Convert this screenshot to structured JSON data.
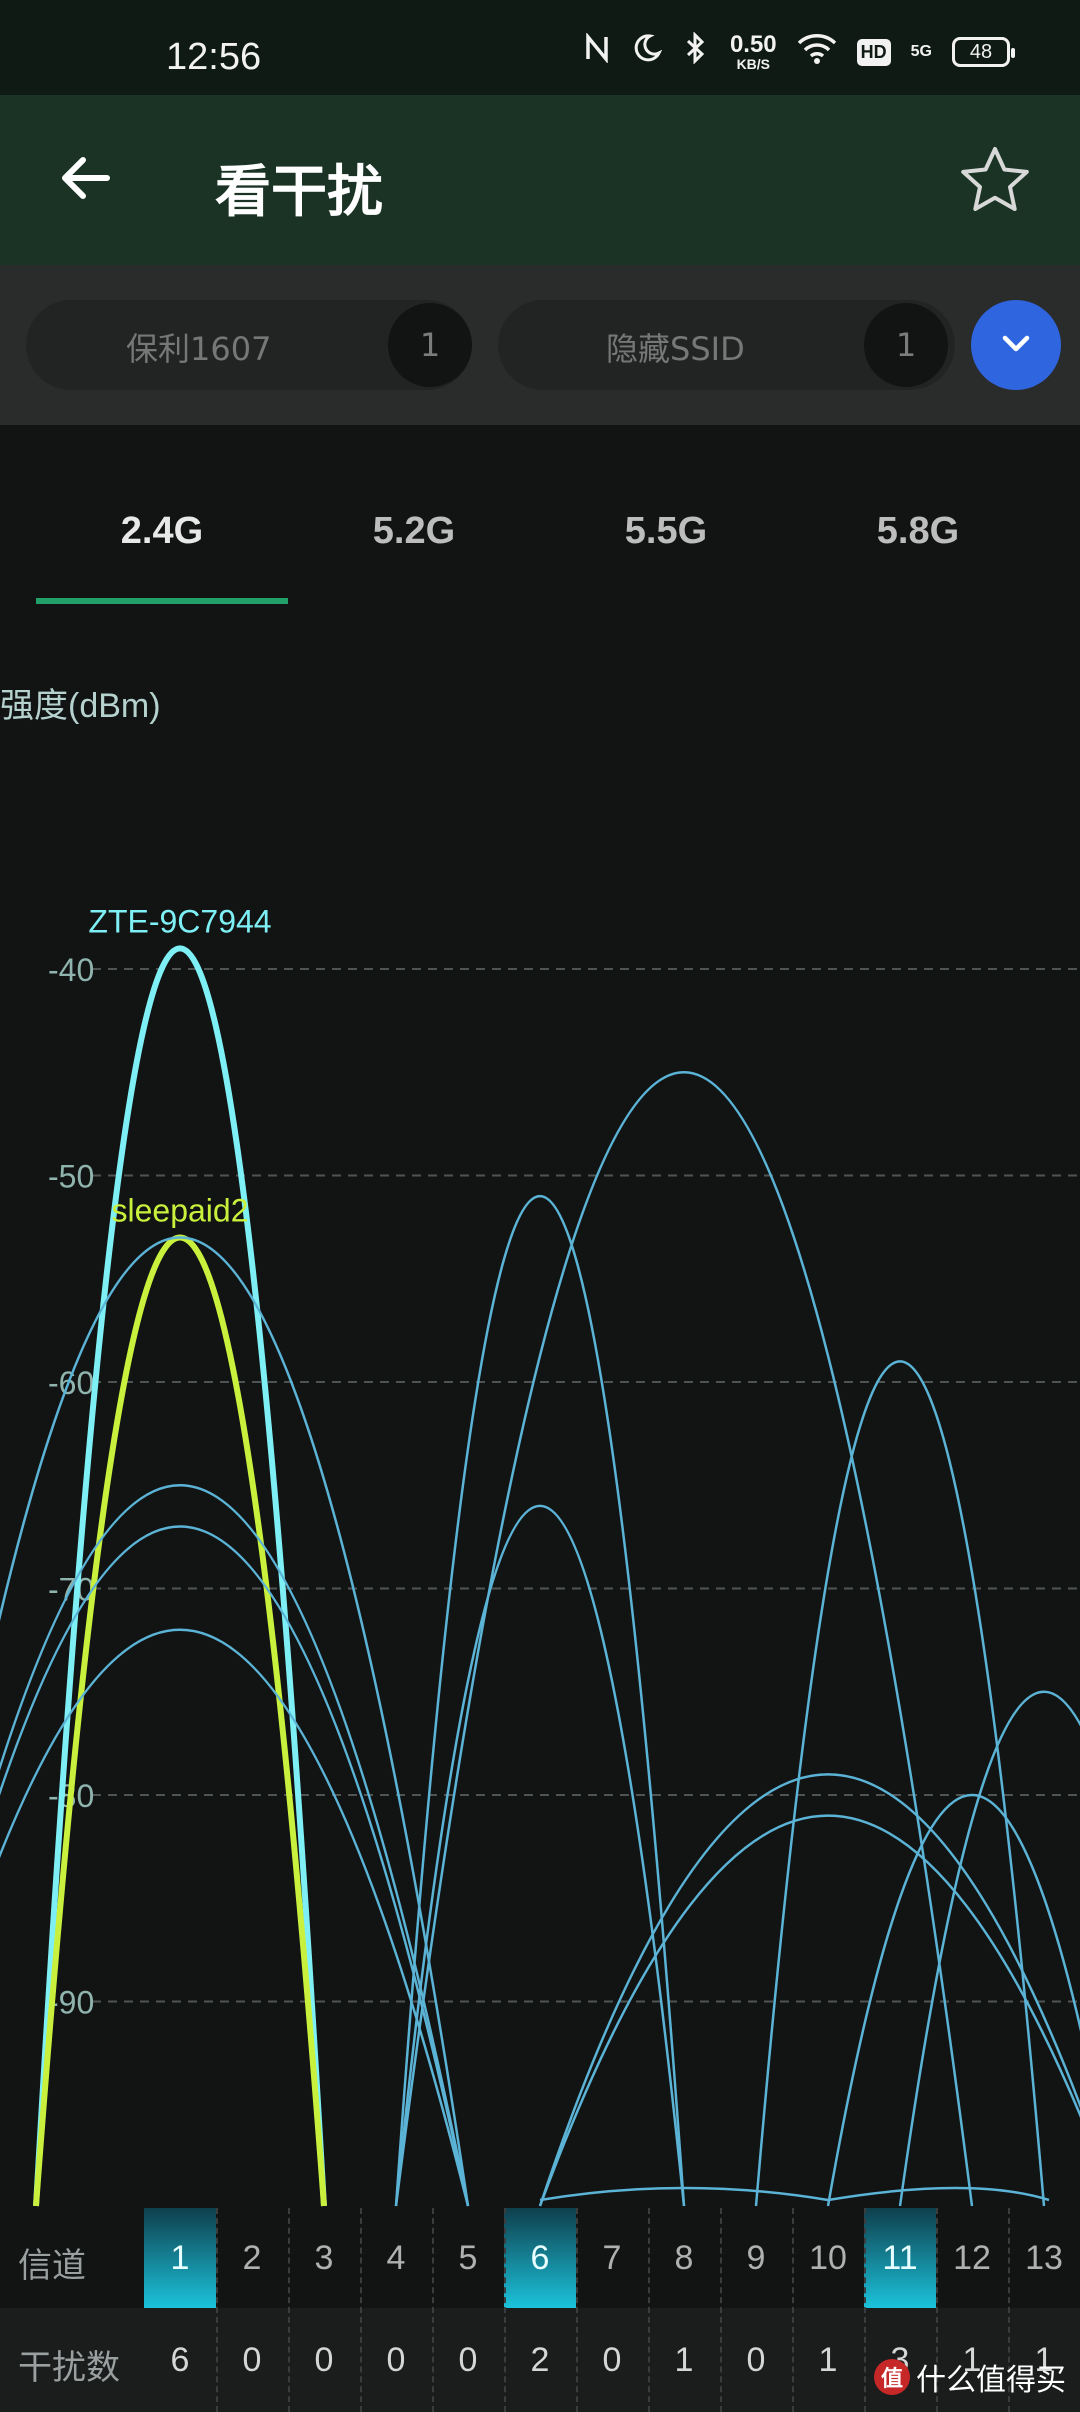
{
  "status_bar": {
    "time": "12:56",
    "speed_value": "0.50",
    "speed_unit": "KB/S",
    "hd_label": "HD",
    "net_label": "5G",
    "battery": "48",
    "icons": [
      "nfc-icon",
      "moon-icon",
      "bluetooth-icon",
      "wifi-icon",
      "hd-icon",
      "signal-icon",
      "battery-icon"
    ]
  },
  "app_bar": {
    "title": "看干扰",
    "back_icon": "back-arrow-icon",
    "favorite_icon": "star-outline-icon"
  },
  "ssid_filters": [
    {
      "name": "保利1607",
      "count": "1"
    },
    {
      "name": "隐藏SSID",
      "count": "1"
    }
  ],
  "expand_icon": "chevron-down-icon",
  "tabs": [
    {
      "label": "2.4G",
      "active": true
    },
    {
      "label": "5.2G",
      "active": false
    },
    {
      "label": "5.5G",
      "active": false
    },
    {
      "label": "5.8G",
      "active": false
    }
  ],
  "chart_data": {
    "type": "line",
    "ylabel": "强度(dBm)",
    "y_ticks": [
      -40,
      -50,
      -60,
      -70,
      -80,
      -90
    ],
    "y_tick_labels": [
      "-40",
      "-50",
      "-60",
      "-70",
      "-80",
      "-90"
    ],
    "ylim": [
      -100,
      -40
    ],
    "grid": true,
    "x_categories": [
      "1",
      "2",
      "3",
      "4",
      "5",
      "6",
      "7",
      "8",
      "9",
      "10",
      "11",
      "12",
      "13"
    ],
    "highlighted_channels": [
      "1",
      "6",
      "11"
    ],
    "labeled_networks": [
      {
        "name": "ZTE-9C7944",
        "color": "#7ef0f5"
      },
      {
        "name": "sleepaid2",
        "color": "#c8f03c"
      }
    ],
    "networks": [
      {
        "label": "ZTE-9C7944",
        "center_channel": 1,
        "width_channels": 4.0,
        "peak_dbm": -39,
        "color": "#7ef0f5"
      },
      {
        "label": "sleepaid2",
        "center_channel": 1,
        "width_channels": 4.0,
        "peak_dbm": -53,
        "color": "#c8f03c"
      },
      {
        "label": "",
        "center_channel": 1,
        "width_channels": 8.0,
        "peak_dbm": -53,
        "color": "#5bb3d6"
      },
      {
        "label": "",
        "center_channel": 1,
        "width_channels": 8.0,
        "peak_dbm": -65,
        "color": "#5bb3d6"
      },
      {
        "label": "",
        "center_channel": 1,
        "width_channels": 8.0,
        "peak_dbm": -67,
        "color": "#5bb3d6"
      },
      {
        "label": "",
        "center_channel": 1,
        "width_channels": 8.0,
        "peak_dbm": -72,
        "color": "#5bb3d6"
      },
      {
        "label": "",
        "center_channel": 6,
        "width_channels": 4.0,
        "peak_dbm": -51,
        "color": "#5bb3d6"
      },
      {
        "label": "",
        "center_channel": 6,
        "width_channels": 4.0,
        "peak_dbm": -66,
        "color": "#5bb3d6"
      },
      {
        "label": "",
        "center_channel": 8,
        "width_channels": 8.0,
        "peak_dbm": -45,
        "color": "#5bb3d6"
      },
      {
        "label": "",
        "center_channel": 11,
        "width_channels": 4.0,
        "peak_dbm": -59,
        "color": "#5bb3d6"
      },
      {
        "label": "",
        "center_channel": 10,
        "width_channels": 8.0,
        "peak_dbm": -79,
        "color": "#5bb3d6"
      },
      {
        "label": "",
        "center_channel": 10,
        "width_channels": 8.0,
        "peak_dbm": -81,
        "color": "#5bb3d6"
      },
      {
        "label": "",
        "center_channel": 12,
        "width_channels": 4.0,
        "peak_dbm": -80,
        "color": "#5bb3d6"
      },
      {
        "label": "",
        "center_channel": 13,
        "width_channels": 4.0,
        "peak_dbm": -75,
        "color": "#5bb3d6"
      }
    ],
    "channel_row_label": "信道",
    "interference_row_label": "干扰数",
    "interference_counts": [
      "6",
      "0",
      "0",
      "0",
      "0",
      "2",
      "0",
      "1",
      "0",
      "1",
      "3",
      "1",
      "1"
    ]
  },
  "watermark": {
    "logo": "值",
    "text": "什么值得买"
  }
}
